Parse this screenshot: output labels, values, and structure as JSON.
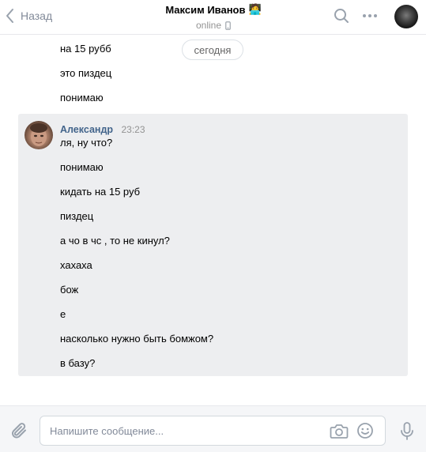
{
  "header": {
    "back_label": "Назад",
    "peer_name": "Максим Иванов",
    "peer_emoji": "🧑‍💻",
    "peer_status": "online"
  },
  "history": {
    "date_separator": "сегодня",
    "previous_lines": [
      "на 15 рубб",
      "это пиздец",
      "понимаю"
    ],
    "group": {
      "sender": "Александр",
      "time": "23:23",
      "lines": [
        "ля, ну что?",
        "понимаю",
        "кидать на 15 руб",
        "пиздец",
        "а чо в чс , то не кинул?",
        "хахаха",
        "бож",
        "е",
        "насколько нужно быть бомжом?",
        "в базу?"
      ]
    }
  },
  "composer": {
    "placeholder": "Напишите сообщение...",
    "value": ""
  },
  "icons": {
    "back": "chevron-left-icon",
    "search": "search-icon",
    "more": "more-dots-icon",
    "mobile": "mobile-phone-icon",
    "attach": "paperclip-icon",
    "camera": "camera-icon",
    "emoji": "smile-icon",
    "mic": "microphone-icon"
  },
  "colors": {
    "link": "#42648b",
    "muted": "#828a99",
    "message_highlight": "#edeef0"
  }
}
